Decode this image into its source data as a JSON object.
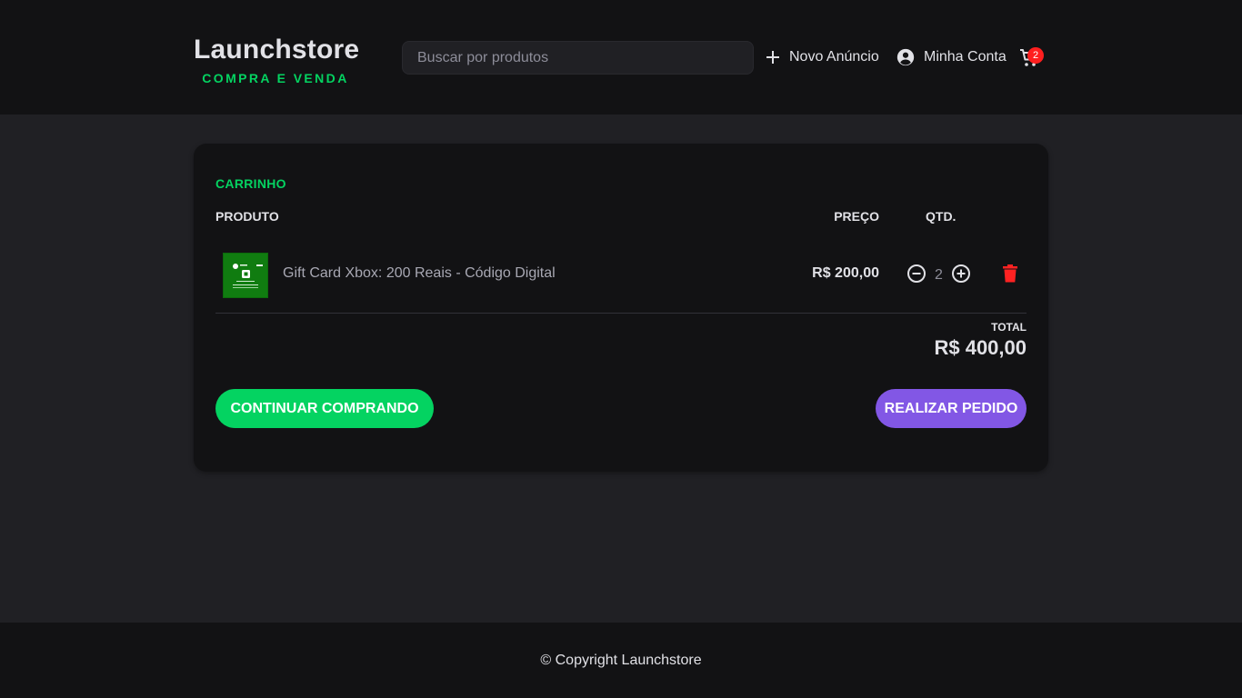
{
  "header": {
    "logo_title": "Launchstore",
    "logo_subtitle": "COMPRA E VENDA",
    "search_placeholder": "Buscar por produtos",
    "new_ad_label": "Novo Anúncio",
    "account_label": "Minha Conta",
    "cart_count": "2"
  },
  "cart": {
    "title": "CARRINHO",
    "col_product": "PRODUTO",
    "col_price": "PREÇO",
    "col_qty": "QTD.",
    "items": [
      {
        "name": "Gift Card Xbox: 200 Reais - Código Digital",
        "price": "R$ 200,00",
        "quantity": "2",
        "image_icon": "xbox-gift-card-image"
      }
    ],
    "total_label": "TOTAL",
    "total_value": "R$ 400,00",
    "continue_button": "CONTINUAR COMPRANDO",
    "order_button": "REALIZAR PEDIDO"
  },
  "footer": {
    "copyright": "© Copyright Launchstore"
  },
  "colors": {
    "background": "#202024",
    "header_bg": "#121214",
    "accent_green": "#04d361",
    "accent_purple": "#8257e5",
    "badge_red": "#ff1f1f"
  }
}
